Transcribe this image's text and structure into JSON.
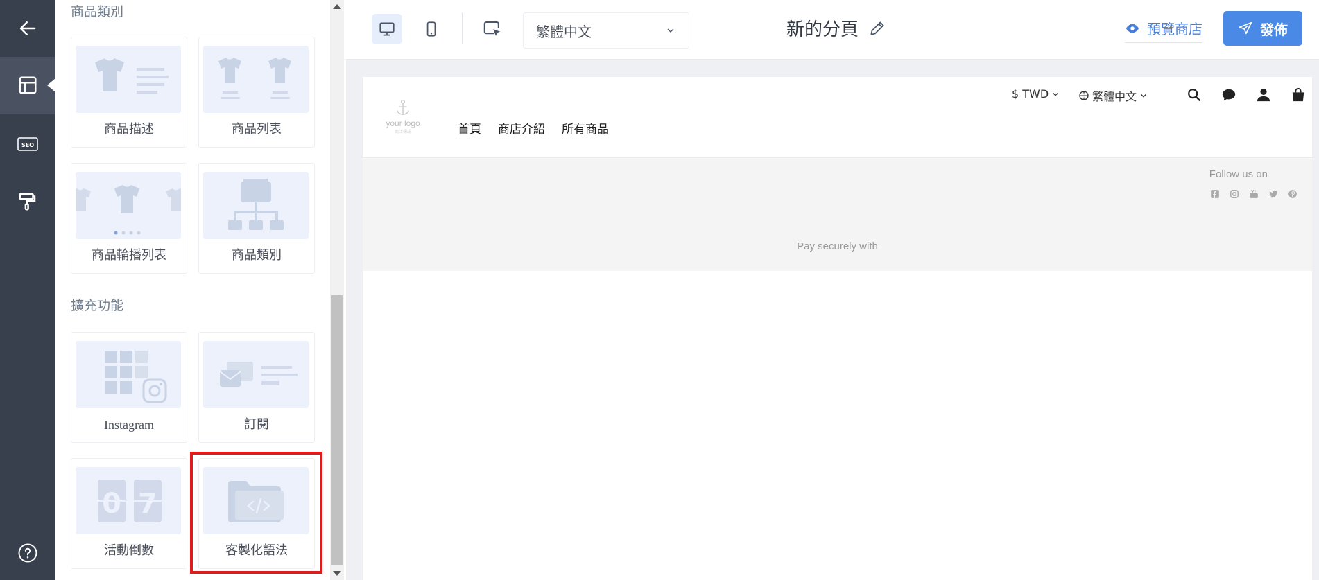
{
  "sidebar": {
    "sections": [
      {
        "title": "商品類別"
      },
      {
        "title": "擴充功能"
      }
    ],
    "tiles": [
      {
        "label": "商品描述",
        "icon": "product-description-icon"
      },
      {
        "label": "商品列表",
        "icon": "product-list-icon"
      },
      {
        "label": "商品輪播列表",
        "icon": "product-carousel-icon"
      },
      {
        "label": "商品類別",
        "icon": "product-category-icon"
      },
      {
        "label": "Instagram",
        "icon": "instagram-grid-icon"
      },
      {
        "label": "訂閱",
        "icon": "subscribe-icon"
      },
      {
        "label": "活動倒數",
        "icon": "countdown-icon"
      },
      {
        "label": "客製化語法",
        "icon": "custom-code-icon"
      }
    ]
  },
  "rail": {
    "items": [
      "back-arrow-icon",
      "layout-icon",
      "seo-icon",
      "paint-roller-icon",
      "help-icon"
    ],
    "seo_text": "SEO"
  },
  "toolbar": {
    "language": "繁體中文",
    "page_title": "新的分頁",
    "preview_label": "預覽商店",
    "publish_label": "發佈"
  },
  "preview": {
    "logo_text": "your logo",
    "logo_sub": "商店標誌",
    "nav": [
      "首頁",
      "商店介紹",
      "所有商品"
    ],
    "currency": "$ TWD",
    "language": "繁體中文",
    "follow_text": "Follow us on",
    "pay_text": "Pay securely with"
  },
  "colors": {
    "rail_bg": "#39404d",
    "accent": "#4a8ae6",
    "highlight": "#e01b1b"
  }
}
